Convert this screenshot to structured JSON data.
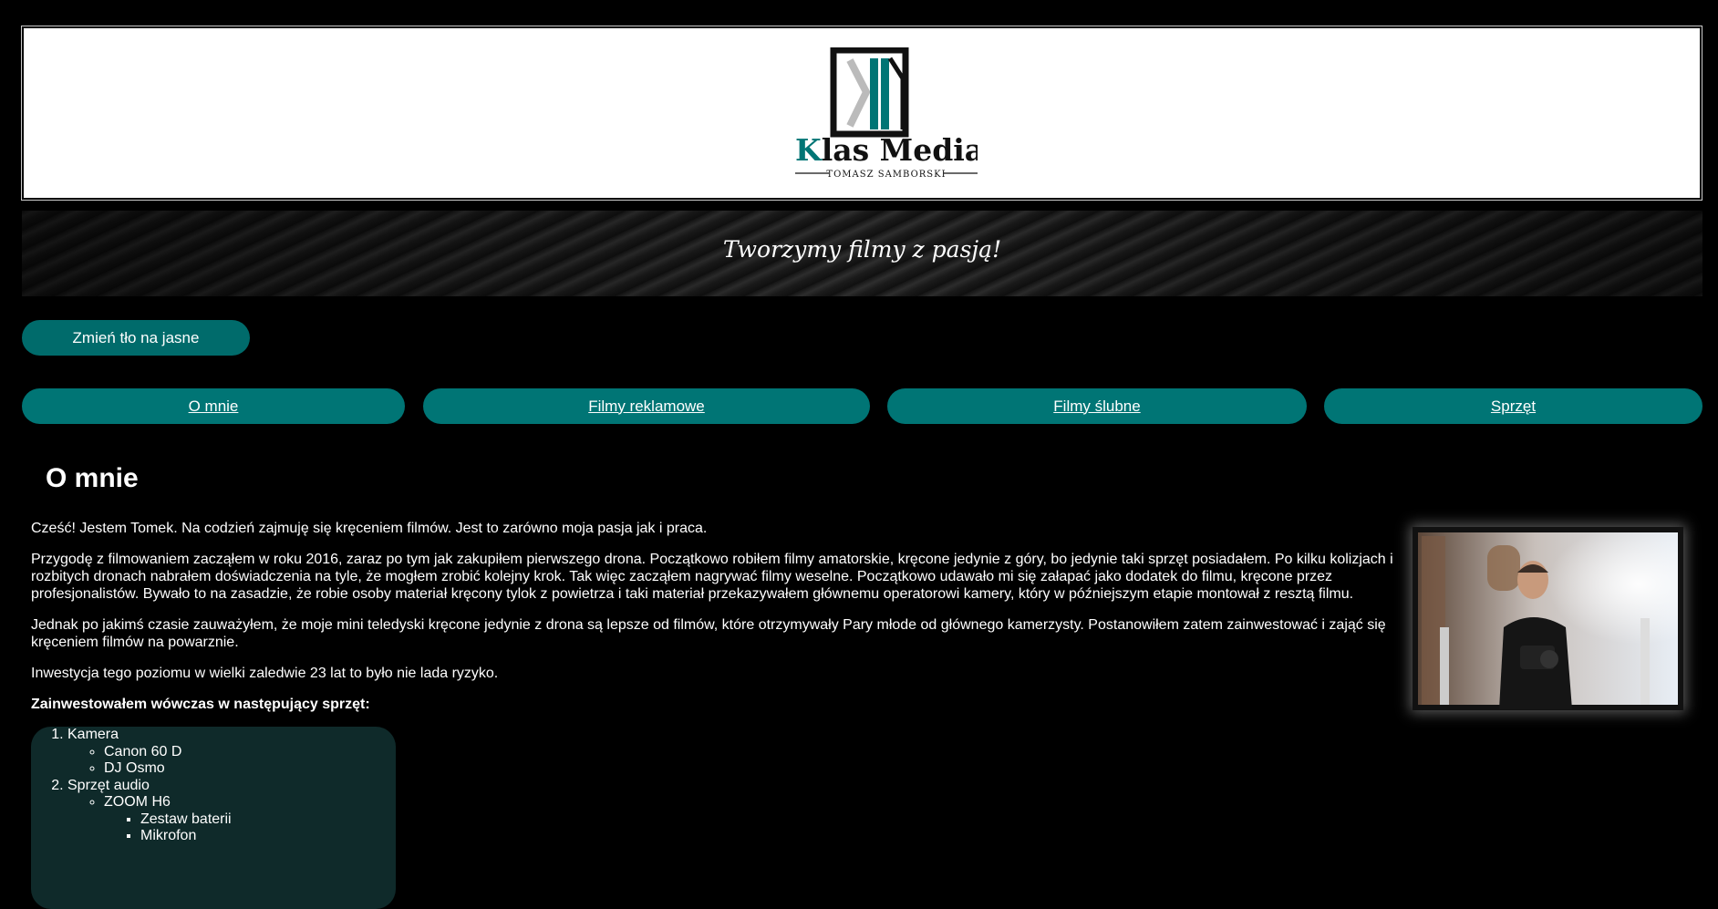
{
  "header": {
    "logo_brand": "Klas Media",
    "logo_sub": "Tomasz Samborski"
  },
  "banner": {
    "tagline": "Tworzymy filmy z pasją!"
  },
  "theme_button": {
    "label": "Zmień tło na jasne"
  },
  "nav": {
    "items": [
      {
        "label": "O mnie"
      },
      {
        "label": "Filmy reklamowe"
      },
      {
        "label": "Filmy ślubne"
      },
      {
        "label": "Sprzęt"
      }
    ]
  },
  "main": {
    "title": "O mnie",
    "paragraphs": [
      "Cześć! Jestem Tomek. Na codzień zajmuję się kręceniem filmów. Jest to zarówno moja pasja jak i praca.",
      "Przygodę z filmowaniem zacząłem w roku 2016, zaraz po tym jak zakupiłem pierwszego drona. Początkowo robiłem filmy amatorskie, kręcone jedynie z góry, bo jedynie taki sprzęt posiadałem. Po kilku kolizjach i rozbitych dronach nabrałem doświadczenia na tyle, że mogłem zrobić kolejny krok. Tak więc zacząłem nagrywać filmy weselne. Początkowo udawało mi się załapać jako dodatek do filmu, kręcone przez profesjonalistów. Bywało to na zasadzie, że robie osoby materiał kręcony tylok z powietrza i taki materiał przekazywałem głównemu operatorowi kamery, który w późniejszym etapie montował z resztą filmu.",
      "Jednak po jakimś czasie zauważyłem, że moje mini teledyski kręcone jedynie z drona są lepsze od filmów, które otrzymywały Pary młode od głównego kamerzysty. Postanowiłem zatem zainwestować i zająć się kręceniem filmów na powarznie.",
      "Inwestycja tego poziomu w wielki zaledwie 23 lat to było nie lada ryzyko.",
      "Zainwestowałem wówczas w następujący sprzęt:"
    ],
    "gear": {
      "camera": {
        "label": "Kamera",
        "items": [
          "Canon 60 D",
          "DJ Osmo"
        ]
      },
      "audio": {
        "label": "Sprzęt audio",
        "zoom": "ZOOM H6",
        "sub_items": [
          "Zestaw baterii",
          "Mikrofon"
        ]
      }
    }
  },
  "colors": {
    "accent": "#007575",
    "background": "#000000"
  }
}
